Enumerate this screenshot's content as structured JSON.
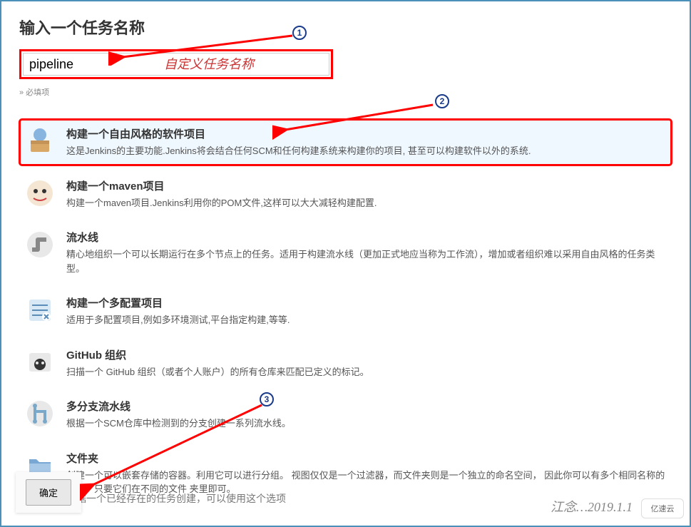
{
  "heading": "输入一个任务名称",
  "name_input": {
    "value": "pipeline",
    "placeholder": ""
  },
  "required_hint": "» 必填项",
  "annotation_custom_name": "自定义任务名称",
  "options": [
    {
      "id": "freestyle",
      "title": "构建一个自由风格的软件项目",
      "desc": "这是Jenkins的主要功能.Jenkins将会结合任何SCM和任何构建系统来构建你的项目, 甚至可以构建软件以外的系统.",
      "selected": true,
      "red_box": true,
      "icon": "box-icon"
    },
    {
      "id": "maven",
      "title": "构建一个maven项目",
      "desc": "构建一个maven项目.Jenkins利用你的POM文件,这样可以大大减轻构建配置.",
      "icon": "maven-icon"
    },
    {
      "id": "pipeline",
      "title": "流水线",
      "desc": "精心地组织一个可以长期运行在多个节点上的任务。适用于构建流水线（更加正式地应当称为工作流），增加或者组织难以采用自由风格的任务类型。",
      "icon": "pipeline-icon"
    },
    {
      "id": "multiconfig",
      "title": "构建一个多配置项目",
      "desc": "适用于多配置项目,例如多环境测试,平台指定构建,等等.",
      "icon": "multiconfig-icon"
    },
    {
      "id": "github-org",
      "title": "GitHub 组织",
      "desc": "扫描一个 GitHub 组织（或者个人账户）的所有仓库来匹配已定义的标记。",
      "icon": "github-icon"
    },
    {
      "id": "multibranch",
      "title": "多分支流水线",
      "desc": "根据一个SCM仓库中检测到的分支创建一系列流水线。",
      "icon": "multibranch-icon"
    },
    {
      "id": "folder",
      "title": "文件夹",
      "desc": "创建一个可以嵌套存储的容器。利用它可以进行分组。 视图仅仅是一个过滤器，而文件夹则是一个独立的命名空间， 因此你可以有多个相同名称的内容，只要它们在不同的文件 夹里即可。",
      "icon": "folder-icon"
    }
  ],
  "copy_hint": "如果你想根据一个已经存在的任务创建，可以使用这个选项",
  "submit_label": "确定",
  "watermark": "江念…2019.1.1",
  "logo_text": "亿速云",
  "markers": {
    "m1": "1",
    "m2": "2",
    "m3": "3"
  }
}
